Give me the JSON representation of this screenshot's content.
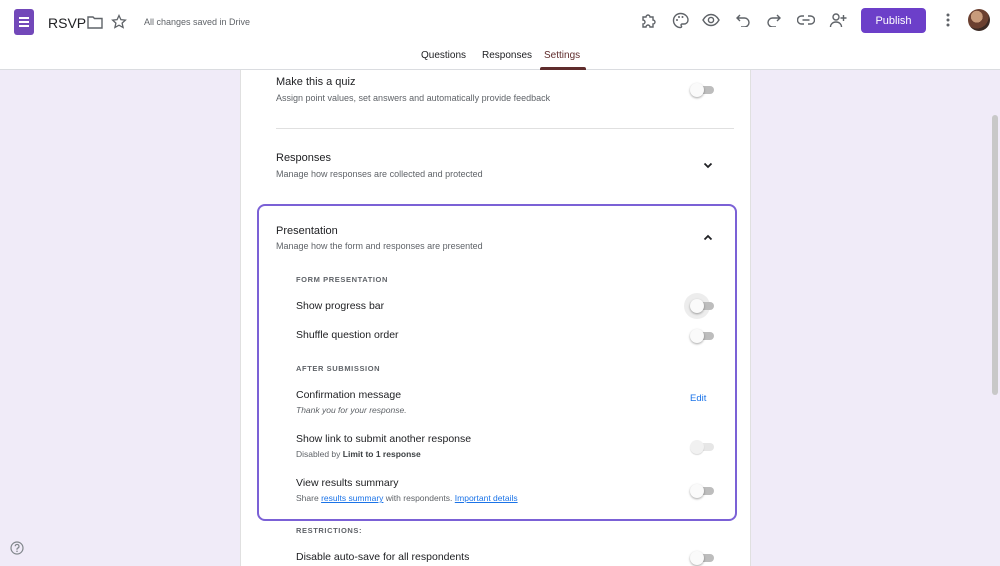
{
  "app": {
    "title": "RSVP",
    "save_status": "All changes saved in Drive",
    "publish_label": "Publish"
  },
  "header_icons": [
    "addon-puzzle-icon",
    "palette-icon",
    "preview-eye-icon",
    "undo-icon",
    "redo-icon",
    "link-icon",
    "add-collaborator-icon"
  ],
  "tabs": [
    {
      "label": "Questions",
      "active": false
    },
    {
      "label": "Responses",
      "active": false
    },
    {
      "label": "Settings",
      "active": true
    }
  ],
  "settings": {
    "quiz": {
      "title": "Make this a quiz",
      "description": "Assign point values, set answers and automatically provide feedback",
      "enabled": false
    },
    "responses": {
      "title": "Responses",
      "description": "Manage how responses are collected and protected",
      "expanded": false
    },
    "presentation": {
      "title": "Presentation",
      "description": "Manage how the form and responses are presented",
      "expanded": true,
      "form_presentation_label": "FORM PRESENTATION",
      "progress_bar": {
        "title": "Show progress bar",
        "enabled": false
      },
      "shuffle": {
        "title": "Shuffle question order",
        "enabled": false
      },
      "after_submission_label": "AFTER SUBMISSION",
      "confirmation": {
        "title": "Confirmation message",
        "message": "Thank you for your response.",
        "edit_label": "Edit"
      },
      "submit_another": {
        "title": "Show link to submit another response",
        "desc_prefix": "Disabled by",
        "desc_bold": "Limit to 1 response",
        "enabled": false,
        "disabled": true
      },
      "results_summary": {
        "title": "View results summary",
        "desc_prefix": "Share",
        "desc_link": "results summary",
        "desc_middle": "with respondents.",
        "desc_link2": "Important details",
        "enabled": false
      }
    },
    "restrictions": {
      "label": "RESTRICTIONS:",
      "autosave": {
        "title": "Disable auto-save for all respondents",
        "enabled": false
      }
    }
  },
  "colors": {
    "accent": "#6c3fc9",
    "background": "#f0ebf8",
    "highlight_border": "#7b61d6",
    "link": "#1a73e8"
  }
}
